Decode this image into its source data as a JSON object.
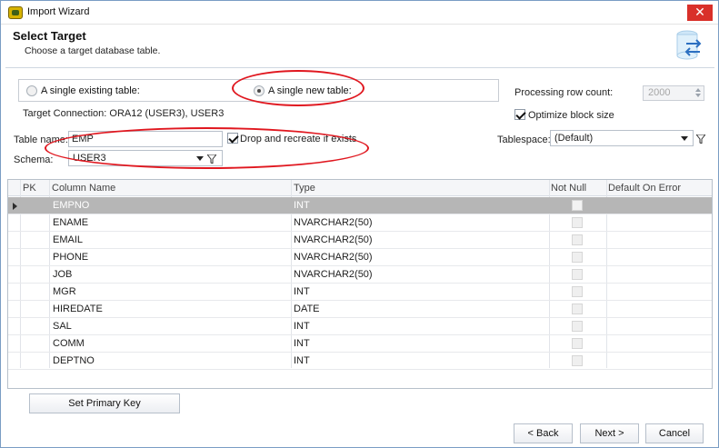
{
  "window": {
    "title": "Import Wizard"
  },
  "header": {
    "title": "Select Target",
    "subtitle": "Choose a target database table."
  },
  "target_options": {
    "single_existing": "A single existing table:",
    "single_new": "A single new table:",
    "selected": "single_new"
  },
  "processing": {
    "label": "Processing row count:",
    "value": "2000",
    "optimize_label": "Optimize block size",
    "optimize_checked": true
  },
  "connection": {
    "label": "Target Connection: ORA12 (USER3), USER3"
  },
  "table": {
    "name_label": "Table name:",
    "name_value": "EMP",
    "drop_label": "Drop and recreate if exists",
    "drop_checked": true,
    "schema_label": "Schema:",
    "schema_value": "USER3",
    "tablespace_label": "Tablespace:",
    "tablespace_value": "(Default)"
  },
  "grid": {
    "columns": [
      "PK",
      "Column Name",
      "Type",
      "Not Null",
      "Default On Error"
    ],
    "rows": [
      {
        "name": "EMPNO",
        "type": "INT"
      },
      {
        "name": "ENAME",
        "type": "NVARCHAR2(50)"
      },
      {
        "name": "EMAIL",
        "type": "NVARCHAR2(50)"
      },
      {
        "name": "PHONE",
        "type": "NVARCHAR2(50)"
      },
      {
        "name": "JOB",
        "type": "NVARCHAR2(50)"
      },
      {
        "name": "MGR",
        "type": "INT"
      },
      {
        "name": "HIREDATE",
        "type": "DATE"
      },
      {
        "name": "SAL",
        "type": "INT"
      },
      {
        "name": "COMM",
        "type": "INT"
      },
      {
        "name": "DEPTNO",
        "type": "INT"
      }
    ]
  },
  "buttons": {
    "set_primary_key": "Set Primary Key",
    "back": "< Back",
    "next": "Next >",
    "cancel": "Cancel"
  },
  "colors": {
    "annotation_red": "#e0171f",
    "selected_row": "#b6b6b6",
    "close_button": "#d9302a"
  }
}
